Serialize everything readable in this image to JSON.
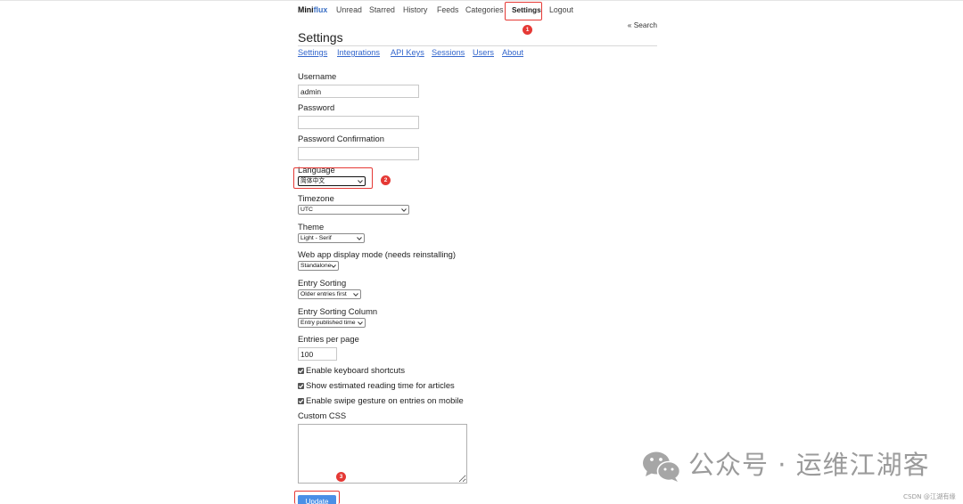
{
  "header": {
    "logo": {
      "part1": "Mini",
      "part2": "flux"
    },
    "nav": [
      {
        "label": "Unread"
      },
      {
        "label": "Starred"
      },
      {
        "label": "History"
      },
      {
        "label": "Feeds"
      },
      {
        "label": "Categories"
      },
      {
        "label": "Settings",
        "active": true
      },
      {
        "label": "Logout"
      }
    ],
    "search_link": "« Search"
  },
  "page": {
    "title": "Settings",
    "tabs": [
      {
        "label": "Settings"
      },
      {
        "label": "Integrations"
      },
      {
        "label": "API Keys"
      },
      {
        "label": "Sessions"
      },
      {
        "label": "Users"
      },
      {
        "label": "About"
      }
    ]
  },
  "form": {
    "username": {
      "label": "Username",
      "value": "admin"
    },
    "password": {
      "label": "Password"
    },
    "password_confirmation": {
      "label": "Password Confirmation"
    },
    "language": {
      "label": "Language",
      "selected": "简体中文"
    },
    "timezone": {
      "label": "Timezone",
      "selected": "UTC"
    },
    "theme": {
      "label": "Theme",
      "selected": "Light - Serif"
    },
    "display_mode": {
      "label": "Web app display mode (needs reinstalling)",
      "selected": "Standalone"
    },
    "entry_sorting": {
      "label": "Entry Sorting",
      "selected": "Older entries first"
    },
    "entry_sorting_column": {
      "label": "Entry Sorting Column",
      "selected": "Entry published time"
    },
    "entries_per_page": {
      "label": "Entries per page",
      "value": "100"
    },
    "checkboxes": [
      {
        "label": "Enable keyboard shortcuts",
        "checked": true
      },
      {
        "label": "Show estimated reading time for articles",
        "checked": true
      },
      {
        "label": "Enable swipe gesture on entries on mobile",
        "checked": true
      }
    ],
    "custom_css": {
      "label": "Custom CSS"
    },
    "submit_label": "Update"
  },
  "annotations": [
    {
      "number": "1"
    },
    {
      "number": "2"
    },
    {
      "number": "3"
    }
  ],
  "watermark": {
    "text": "公众号 · 运维江湖客",
    "source": "CSDN @江湖有缘"
  },
  "icons": {
    "select_arrow": "chevron-down-icon",
    "checkbox_mark": "check-icon",
    "watermark_logo": "wechat-icon"
  },
  "colors": {
    "link": "#3366cc",
    "logo_accent": "#3a6fc4",
    "annotation": "#e53935",
    "button": "#4a8fe6",
    "watermark": "#9b9b9b"
  }
}
